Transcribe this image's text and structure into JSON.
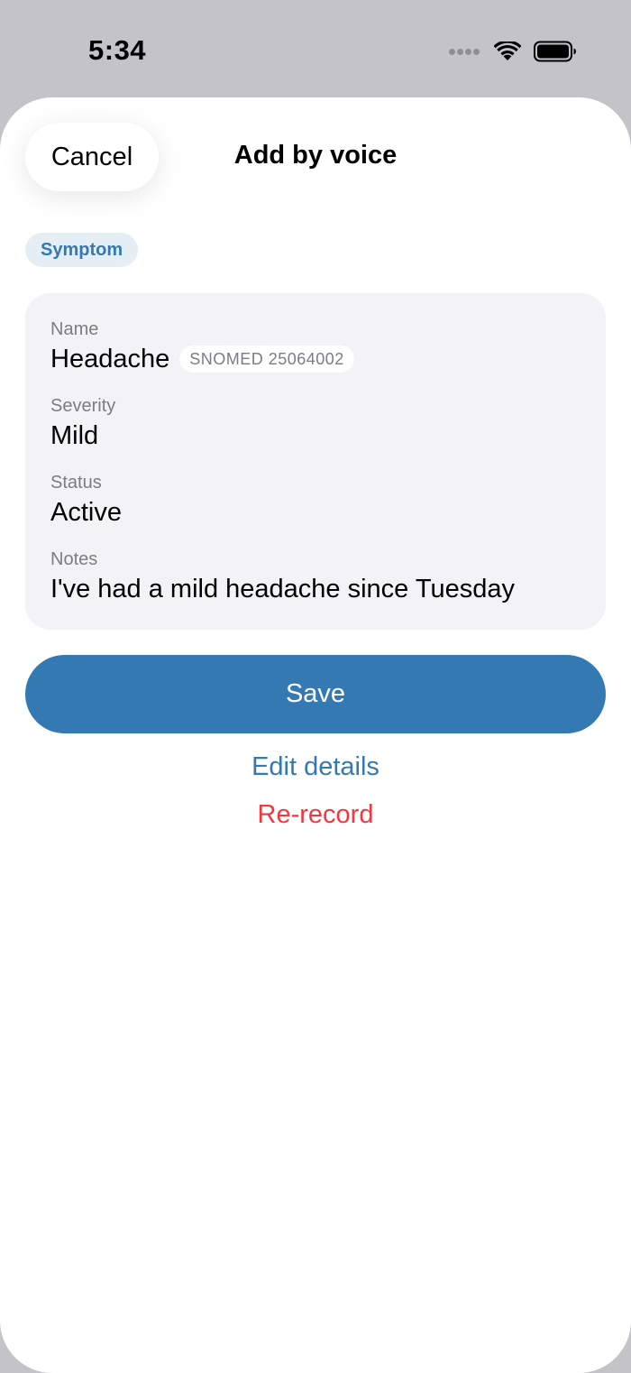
{
  "status_bar": {
    "time": "5:34",
    "icons": [
      "cellular-dots-icon",
      "wifi-icon",
      "battery-icon"
    ]
  },
  "header": {
    "cancel_label": "Cancel",
    "title": "Add by voice"
  },
  "category": {
    "label": "Symptom"
  },
  "card": {
    "fields": [
      {
        "label": "Name",
        "value": "Headache",
        "code": "SNOMED 25064002"
      },
      {
        "label": "Severity",
        "value": "Mild"
      },
      {
        "label": "Status",
        "value": "Active"
      },
      {
        "label": "Notes",
        "value": "I've had a mild headache since Tuesday"
      }
    ]
  },
  "actions": {
    "save_label": "Save",
    "edit_label": "Edit details",
    "rerecord_label": "Re-record"
  },
  "colors": {
    "accent": "#3479b1",
    "destructive": "#f2383f",
    "card_background": "#f2f2f7",
    "pill_background": "#e6eef5",
    "secondary_text": "#7c7c82",
    "backdrop": "#c4c4c8"
  }
}
